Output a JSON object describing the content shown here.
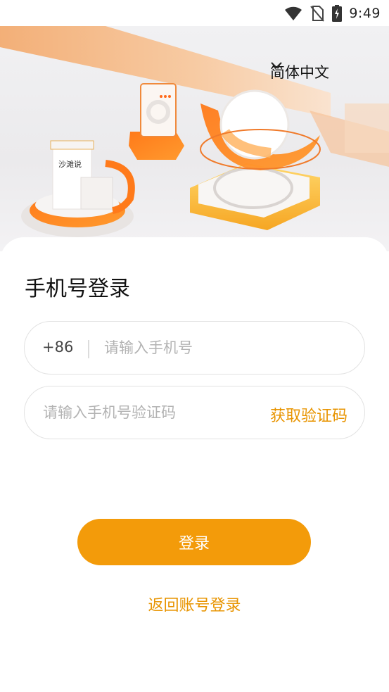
{
  "status_bar": {
    "time": "9:49",
    "icons": [
      "wifi-icon",
      "no-sim-icon",
      "battery-charging-icon"
    ]
  },
  "hero": {
    "building_sign": "沙滩说",
    "language_selector": {
      "label": "简体中文",
      "icon": "chevron-down-icon"
    }
  },
  "login_form": {
    "title": "手机号登录",
    "phone_field": {
      "country_code": "+86",
      "placeholder": "请输入手机号",
      "value": ""
    },
    "code_field": {
      "placeholder": "请输入手机号验证码",
      "value": "",
      "get_code_label": "获取验证码"
    },
    "login_button": "登录",
    "back_link": "返回账号登录"
  },
  "colors": {
    "accent": "#f39b0a",
    "accent_text": "#e89400",
    "input_border": "#e2e2e2",
    "placeholder": "#b3b3b3"
  }
}
